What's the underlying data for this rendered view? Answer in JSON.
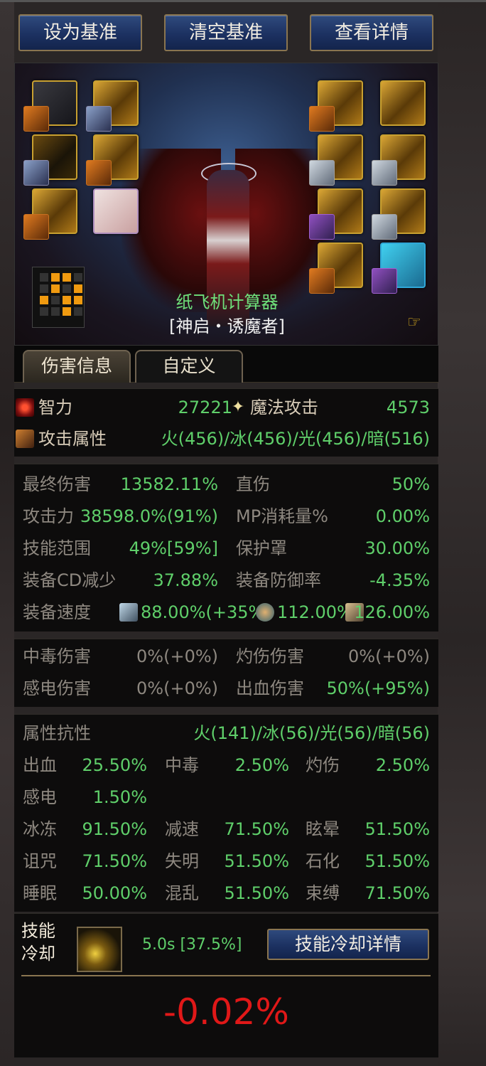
{
  "top_buttons": {
    "set_base": "设为基准",
    "clear_base": "清空基准",
    "view_details": "查看详情"
  },
  "character": {
    "name": "纸飞机计算器",
    "class": "[神启・诱魔者]"
  },
  "tabs": [
    "伤害信息",
    "自定义"
  ],
  "primary": {
    "int_label": "智力",
    "int_value": "27221",
    "matk_label": "魔法攻击",
    "matk_value": "4573",
    "element_label": "攻击属性",
    "element_value": "火(456)/冰(456)/光(456)/暗(516)"
  },
  "stats": {
    "final_damage_label": "最终伤害",
    "final_damage_value": "13582.11%",
    "direct_label": "直伤",
    "direct_value": "50%",
    "attack_label": "攻击力",
    "attack_value": "38598.0%(91%)",
    "mp_label": "MP消耗量%",
    "mp_value": "0.00%",
    "range_label": "技能范围",
    "range_value": "49%[59%]",
    "shield_label": "保护罩",
    "shield_value": "30.00%",
    "cd_label": "装备CD减少",
    "cd_value": "37.88%",
    "def_label": "装备防御率",
    "def_value": "-4.35%",
    "speed_label": "装备速度",
    "speed_attack": "88.00%(+35%)",
    "speed_cast": "112.00%",
    "speed_move": "126.00%"
  },
  "dots": {
    "poison_label": "中毒伤害",
    "poison_value": "0%(+0%)",
    "burn_label": "灼伤伤害",
    "burn_value": "0%(+0%)",
    "shock_label": "感电伤害",
    "shock_value": "0%(+0%)",
    "bleed_label": "出血伤害",
    "bleed_value": "50%(+95%)"
  },
  "resist": {
    "header_label": "属性抗性",
    "header_value": "火(141)/冰(56)/光(56)/暗(56)",
    "rows": [
      [
        [
          "出血",
          "25.50%"
        ],
        [
          "中毒",
          "2.50%"
        ],
        [
          "灼伤",
          "2.50%"
        ]
      ],
      [
        [
          "感电",
          "1.50%"
        ]
      ],
      [
        [
          "冰冻",
          "91.50%"
        ],
        [
          "减速",
          "71.50%"
        ],
        [
          "眩晕",
          "51.50%"
        ]
      ],
      [
        [
          "诅咒",
          "71.50%"
        ],
        [
          "失明",
          "51.50%"
        ],
        [
          "石化",
          "51.50%"
        ]
      ],
      [
        [
          "睡眠",
          "50.00%"
        ],
        [
          "混乱",
          "51.50%"
        ],
        [
          "束缚",
          "71.50%"
        ]
      ]
    ]
  },
  "cooldown": {
    "label_line1": "技能",
    "label_line2": "冷却",
    "value": "5.0s [37.5%]",
    "button": "技能冷却详情"
  },
  "result": "-0.02%",
  "colors": {
    "accent_green": "#5fcf6a",
    "name_green": "#6ee07a",
    "result_red": "#e01818",
    "button_blue": "#1c3161",
    "border_gold": "#8a7550"
  }
}
